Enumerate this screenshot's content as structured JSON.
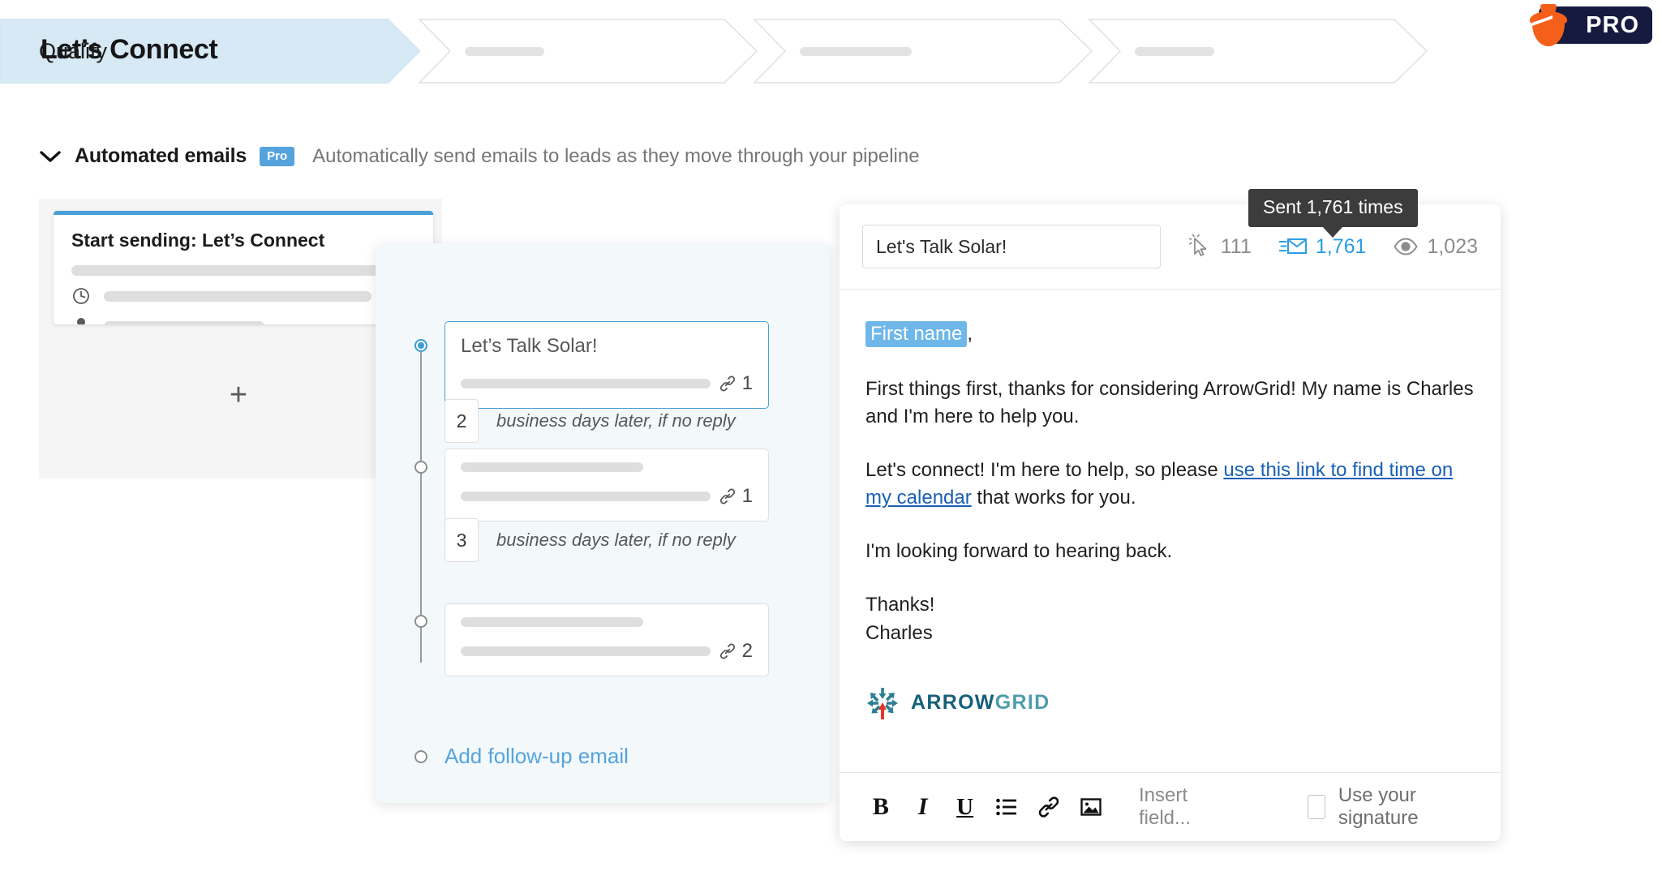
{
  "pro_badge": {
    "label": "PRO",
    "icon": "acorn-icon",
    "pill_color": "#161a3e",
    "acorn_color": "#f4601a"
  },
  "pipeline": {
    "stages": [
      {
        "label": "Qualify",
        "active": true
      },
      {
        "label": "",
        "active": false
      },
      {
        "label": "",
        "active": false
      },
      {
        "label": "",
        "active": false
      }
    ],
    "active_fill": "#d6e9f5"
  },
  "section": {
    "chevron": "chevron-down-icon",
    "title": "Automated emails",
    "badge": "Pro",
    "badge_color": "#54a3dd",
    "description": "Automatically send emails to leads as they move through your pipeline"
  },
  "start_card": {
    "title": "Start sending: Let’s Connect",
    "accent_color": "#4a9fd8",
    "rows": [
      {
        "icon": "clock-icon"
      },
      {
        "icon": "person-icon"
      }
    ],
    "add_label": "+"
  },
  "sequence": {
    "title": "Let’s Connect",
    "steps": [
      {
        "type": "email",
        "subject": "Let’s Talk Solar!",
        "link_count": "1",
        "selected": true
      },
      {
        "type": "delay",
        "days": "2",
        "text": "business days later, if no reply"
      },
      {
        "type": "email",
        "subject": "",
        "link_count": "1",
        "selected": false
      },
      {
        "type": "delay",
        "days": "3",
        "text": "business days later, if no reply"
      },
      {
        "type": "email",
        "subject": "",
        "link_count": "2",
        "selected": false
      }
    ],
    "add_followup_label": "Add follow-up email",
    "add_followup_color": "#55a4dd"
  },
  "editor": {
    "subject_value": "Let's Talk Solar!",
    "stats": [
      {
        "icon": "click-cursor-icon",
        "value": "111",
        "highlight": false
      },
      {
        "icon": "sent-envelope-icon",
        "value": "1,761",
        "highlight": true
      },
      {
        "icon": "eye-icon",
        "value": "1,023",
        "highlight": false
      }
    ],
    "tooltip": "Sent 1,761 times",
    "body": {
      "greeting_tag": "First name",
      "greeting_suffix": ",",
      "paragraph1": "First things first, thanks for considering ArrowGrid! My name is Charles and I'm here to help you.",
      "paragraph2_pre": "Let's connect! I'm here to help, so please ",
      "paragraph2_link": "use this link to find time on my calendar",
      "paragraph2_post": " that works for you.",
      "paragraph3": "I'm looking forward to hearing back.",
      "signoff1": "Thanks!",
      "signoff2": "Charles"
    },
    "signature_logo": {
      "text1": "ARROW",
      "text2": "GRID"
    },
    "toolbar": {
      "bold": "B",
      "italic": "I",
      "underline": "U",
      "list_icon": "bullet-list-icon",
      "link_icon": "link-icon",
      "image_icon": "image-icon",
      "insert_field": "Insert field...",
      "signature_label": "Use your signature"
    }
  }
}
